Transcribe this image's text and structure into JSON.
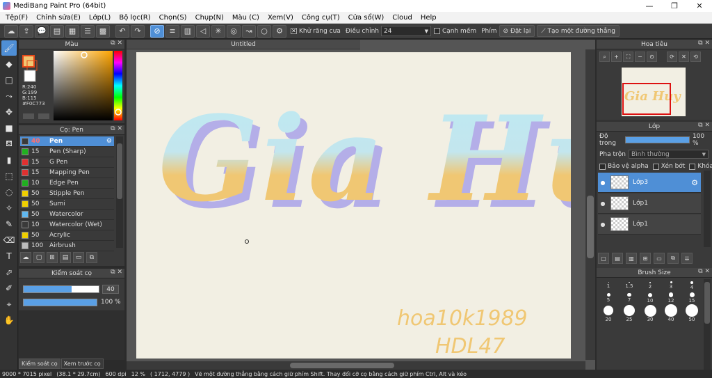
{
  "window": {
    "title": "MediBang Paint Pro (64bit)",
    "min": "—",
    "max": "❐",
    "close": "✕"
  },
  "menu": [
    "Tệp(F)",
    "Chỉnh sửa(E)",
    "Lớp(L)",
    "Bộ lọc(R)",
    "Chọn(S)",
    "Chụp(N)",
    "Màu (C)",
    "Xem(V)",
    "Công cụ(T)",
    "Cửa sổ(W)",
    "Cloud",
    "Help"
  ],
  "toolbar": {
    "antialias_label": "Khử răng cưa",
    "adjust_label": "Điều chỉnh",
    "adjust_value": "24",
    "smooth_label": "Cạnh mềm",
    "key_label": "Phím",
    "reset_label": "Đặt lại",
    "straight_label": "Tạo một đường thẳng"
  },
  "color_panel": {
    "title": "Màu",
    "r": "R:240",
    "g": "G:199",
    "b": "B:115",
    "hex": "#F0C773",
    "primary_color": "#F0C773",
    "secondary_color": "#FFFFFF"
  },
  "brush_panel": {
    "title": "Cọ: Pen",
    "items": [
      {
        "size": "40",
        "name": "Pen",
        "color": "#3a3a3a"
      },
      {
        "size": "15",
        "name": "Pen (Sharp)",
        "color": "#20b020"
      },
      {
        "size": "15",
        "name": "G Pen",
        "color": "#e03030"
      },
      {
        "size": "15",
        "name": "Mapping Pen",
        "color": "#e03030"
      },
      {
        "size": "10",
        "name": "Edge Pen",
        "color": "#20b020"
      },
      {
        "size": "50",
        "name": "Stipple Pen",
        "color": "#f0d000"
      },
      {
        "size": "50",
        "name": "Sumi",
        "color": "#f0d000"
      },
      {
        "size": "50",
        "name": "Watercolor",
        "color": "#60b8f0"
      },
      {
        "size": "10",
        "name": "Watercolor (Wet)",
        "color": "#3a3a3a"
      },
      {
        "size": "50",
        "name": "Acrylic",
        "color": "#f0d000"
      },
      {
        "size": "100",
        "name": "Airbrush",
        "color": "#bbbbbb"
      }
    ]
  },
  "brush_control": {
    "title": "Kiểm soát cọ",
    "size_value": "40",
    "size_fraction": 0.64,
    "opacity_value": "100 %",
    "opacity_fraction": 1.0
  },
  "left_tabs": [
    "Kiểm soát cọ",
    "Xem trước cọ"
  ],
  "canvas": {
    "doc_title": "Untitled",
    "artwork_main": "Gia Huy",
    "artwork_sub1": "hoa10k1989",
    "artwork_sub2": "HDL47"
  },
  "navigator": {
    "title": "Hoa tiêu"
  },
  "layer_panel": {
    "title": "Lớp",
    "opacity_label": "Độ trong",
    "opacity_value": "100 %",
    "blend_label": "Pha trộn",
    "blend_value": "Bình thường",
    "protect_alpha": "Bảo vệ alpha",
    "clipping": "Xén bớt",
    "lock": "Khóa",
    "layers": [
      "Lớp3",
      "Lớp1",
      "Lớp1"
    ]
  },
  "brush_size": {
    "title": "Brush Size",
    "sizes": [
      "1",
      "1.5",
      "2",
      "3",
      "4",
      "5",
      "7",
      "10",
      "12",
      "15",
      "20",
      "25",
      "30",
      "40",
      "50"
    ]
  },
  "status": {
    "dimensions": "9000 * 7015 pixel",
    "physical": "(38.1 * 29.7cm)",
    "dpi": "600 dpi",
    "zoom": "12 %",
    "coords": "( 1712, 4779 )",
    "hint": "Vẽ một đường thẳng bằng cách giữ phím Shift. Thay đổi cỡ cọ bằng cách giữ phím Ctrl, Alt và kéo"
  }
}
